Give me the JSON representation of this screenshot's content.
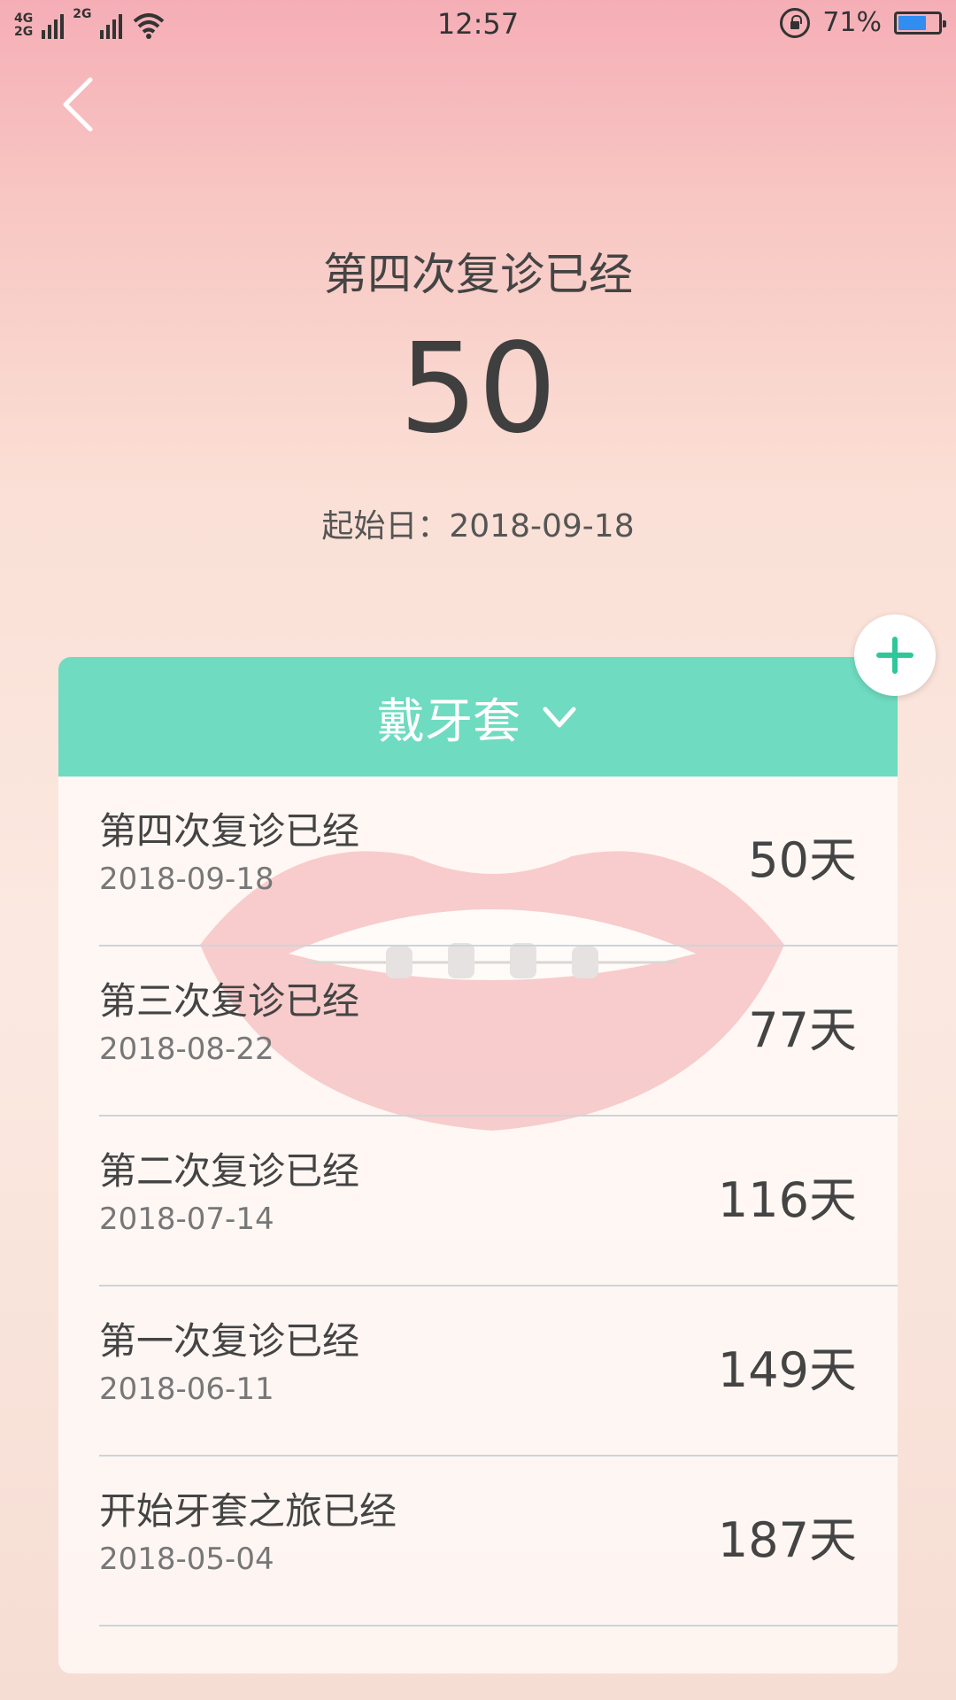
{
  "status_bar": {
    "net_top": "4G",
    "net_bottom": "2G",
    "net_mid": "2G",
    "time": "12:57",
    "battery_percent": "71%",
    "battery_level": 0.71,
    "battery_color": "#2f8ef0"
  },
  "header": {
    "title": "第四次复诊已经",
    "count": "50",
    "start_label": "起始日：2018-09-18"
  },
  "card": {
    "category": "戴牙套",
    "accent_color": "#6fdbc0",
    "items": [
      {
        "title": "第四次复诊已经",
        "date": "2018-09-18",
        "days": "50天"
      },
      {
        "title": "第三次复诊已经",
        "date": "2018-08-22",
        "days": "77天"
      },
      {
        "title": "第二次复诊已经",
        "date": "2018-07-14",
        "days": "116天"
      },
      {
        "title": "第一次复诊已经",
        "date": "2018-06-11",
        "days": "149天"
      },
      {
        "title": "开始牙套之旅已经",
        "date": "2018-05-04",
        "days": "187天"
      }
    ]
  },
  "icons": {
    "back": "back-chevron-icon",
    "add": "plus-icon",
    "dropdown": "chevron-down-icon",
    "wifi": "wifi-icon",
    "lock": "rotation-lock-icon",
    "battery": "battery-icon"
  }
}
